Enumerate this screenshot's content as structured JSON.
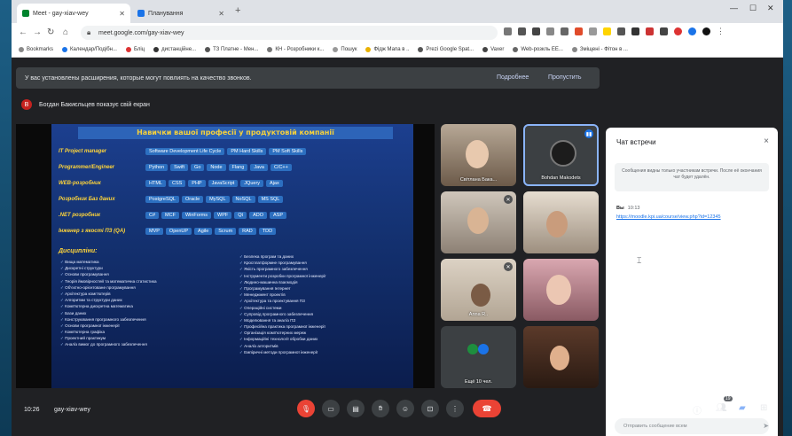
{
  "browser": {
    "tabs": [
      {
        "label": "Meet - gay-xiav-wey",
        "active": true
      },
      {
        "label": "Планування",
        "active": false
      }
    ],
    "url": "meet.google.com/gay-xiav-wey",
    "bookmarks": [
      "Bookmarks",
      "Календар/Подібн...",
      "Бліц",
      "дистанційне...",
      "ТЗ Платне - Мен...",
      "КН - Розробники к...",
      "Пошук",
      "Фідж Мапа в ..",
      "Prezi Google Spat...",
      "Vaxer",
      "Web-розкль ЕЕ...",
      "Зміщені - Фітон в ..."
    ]
  },
  "banner": {
    "text": "У вас установлены расширения, которые могут повлиять на качество звонков.",
    "action1": "Подробнее",
    "action2": "Пропустить"
  },
  "presenting": {
    "avatar_letter": "B",
    "text": "Богдан Бакиєльцев показує свій екран"
  },
  "slide": {
    "title": "Навички вашої професії у продуктовій компанії",
    "rows": [
      {
        "label": "IT Project manager",
        "chips": [
          "Software Development Life Cycle",
          "PM Hard Skills",
          "PM Soft Skills"
        ]
      },
      {
        "label": "Programmer/Engineer",
        "chips": [
          "Python",
          "Swift",
          "Go",
          "Node",
          "Flang",
          "Java",
          "C/C++"
        ]
      },
      {
        "label": "WEB-розробник",
        "chips": [
          "HTML",
          "CSS",
          "PHP",
          "JavaScript",
          "JQuery",
          "Ajax"
        ]
      },
      {
        "label": "Розробник Баз даних",
        "chips": [
          "PostgreSQL",
          "Oracle",
          "MySQL",
          "NoSQL",
          "MS SQL"
        ]
      },
      {
        "label": ".NET розробник",
        "chips": [
          "C#",
          "MCF",
          "WinForms",
          "WPF",
          "Qt",
          "ADO",
          "ASP"
        ]
      },
      {
        "label": "Інженер з якості ПЗ (QA)",
        "chips": [
          "MVP",
          "OpenUP",
          "Agile",
          "Scrum",
          "RAD",
          "TDD"
        ]
      }
    ],
    "disciplines_title": "Дисципліни:",
    "left_col": [
      "Вища математика",
      "Дискретні структури",
      "Основи програмування",
      "Теорія ймовірностей та математична статистика",
      "Об'єктно-орієнтоване програмування",
      "Архітектура комп'ютерів",
      "Алгоритми та структури даних",
      "Комп'ютерна дискретна математика",
      "Бази даних",
      "Конструювання програмного забезпечення",
      "Основи програмної інженерії",
      "Комп'ютерна графіка",
      "Проектний практикум",
      "Аналіз вимог до програмного забезпечення"
    ],
    "right_col": [
      "Безпека програм та даних",
      "Кросплатформне програмування",
      "Якість програмного забезпечення",
      "Інструменти розробки програмної інженерії",
      "Людино-машинна взаємодія",
      "Програмування Інтернет",
      "Менеджмент проектів",
      "Архітектура та проектування ПЗ",
      "Операційні системи",
      "Супровід програмного забезпечення",
      "Моделювання та аналіз ПЗ",
      "Професійна практика програмної інженерії",
      "Організація комп'ютерних мереж",
      "Інформаційні технології обробки даних",
      "Аналіз алгоритмів",
      "Емпіричні методи програмної інженерії"
    ]
  },
  "participants": [
    {
      "name": "Світлана Бака...",
      "muted": false
    },
    {
      "name": "Bohdan Makodets",
      "muted": false
    },
    {
      "name": "",
      "muted": true
    },
    {
      "name": "",
      "muted": false
    },
    {
      "name": "Anna R..",
      "muted": true
    },
    {
      "name": "",
      "muted": false
    },
    {
      "name": "Ещё 10 чел.",
      "muted": false
    },
    {
      "name": "",
      "muted": false
    }
  ],
  "chat": {
    "title": "Чат встречи",
    "notice": "Сообщения видны только участникам встречи. После её окончания чат будет удалён.",
    "sender": "Вы",
    "sent_time": "10:13",
    "message_link": "https://moodle.kpi.ua/course/view.php?id=12345",
    "input_placeholder": "Отправить сообщение всем",
    "close_label": "×"
  },
  "bottom": {
    "time": "10:26",
    "meeting_code": "gay-xiav-wey",
    "participants_count": "19"
  }
}
